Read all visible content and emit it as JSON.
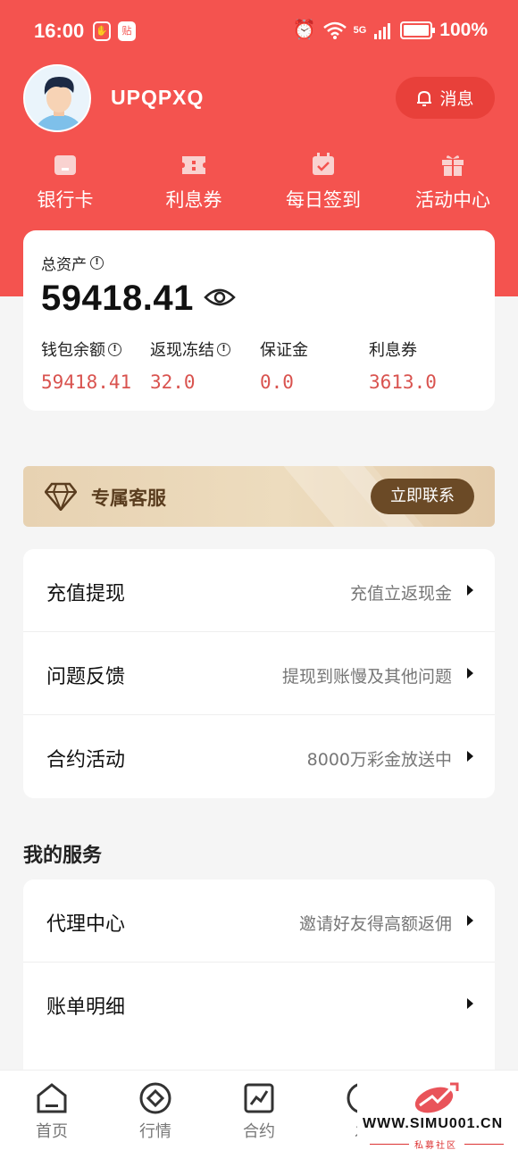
{
  "status_bar": {
    "time": "16:00",
    "badge": "贴",
    "network": "5G",
    "battery": "100%",
    "battery_level": 1.0
  },
  "profile": {
    "username": "UPQPXQ",
    "message_button": "消息"
  },
  "quick_actions": [
    {
      "label": "银行卡",
      "icon": "bank-card-icon"
    },
    {
      "label": "利息券",
      "icon": "ticket-icon"
    },
    {
      "label": "每日签到",
      "icon": "calendar-check-icon"
    },
    {
      "label": "活动中心",
      "icon": "gift-icon"
    }
  ],
  "assets": {
    "total_label": "总资产",
    "total_value": "59418.41",
    "stats": [
      {
        "label": "钱包余额",
        "value": "59418.41",
        "has_info": true
      },
      {
        "label": "返现冻结",
        "value": "32.0",
        "has_info": true
      },
      {
        "label": "保证金",
        "value": "0.0",
        "has_info": false
      },
      {
        "label": "利息券",
        "value": "3613.0",
        "has_info": false
      }
    ]
  },
  "vip_banner": {
    "title": "专属客服",
    "button": "立即联系"
  },
  "menu_main": [
    {
      "title": "充值提现",
      "desc": "充值立返现金"
    },
    {
      "title": "问题反馈",
      "desc": "提现到账慢及其他问题"
    },
    {
      "title": "合约活动",
      "desc": "8000万彩金放送中"
    }
  ],
  "services": {
    "section_title": "我的服务",
    "items": [
      {
        "title": "代理中心",
        "desc": "邀请好友得高额返佣"
      },
      {
        "title": "账单明细",
        "desc": ""
      }
    ]
  },
  "bottom_nav": [
    {
      "label": "首页",
      "icon": "home-icon",
      "active": true
    },
    {
      "label": "行情",
      "icon": "market-icon",
      "active": false
    },
    {
      "label": "合约",
      "icon": "contract-chart-icon",
      "active": false
    },
    {
      "label": "发",
      "icon": "discover-icon",
      "active": false
    }
  ],
  "watermark": {
    "text": "WWW.SIMU001.CN",
    "sub": "私募社区"
  },
  "colors": {
    "primary": "#f4534f",
    "value_red": "#d9534f",
    "vip_button": "#6b4a26"
  }
}
